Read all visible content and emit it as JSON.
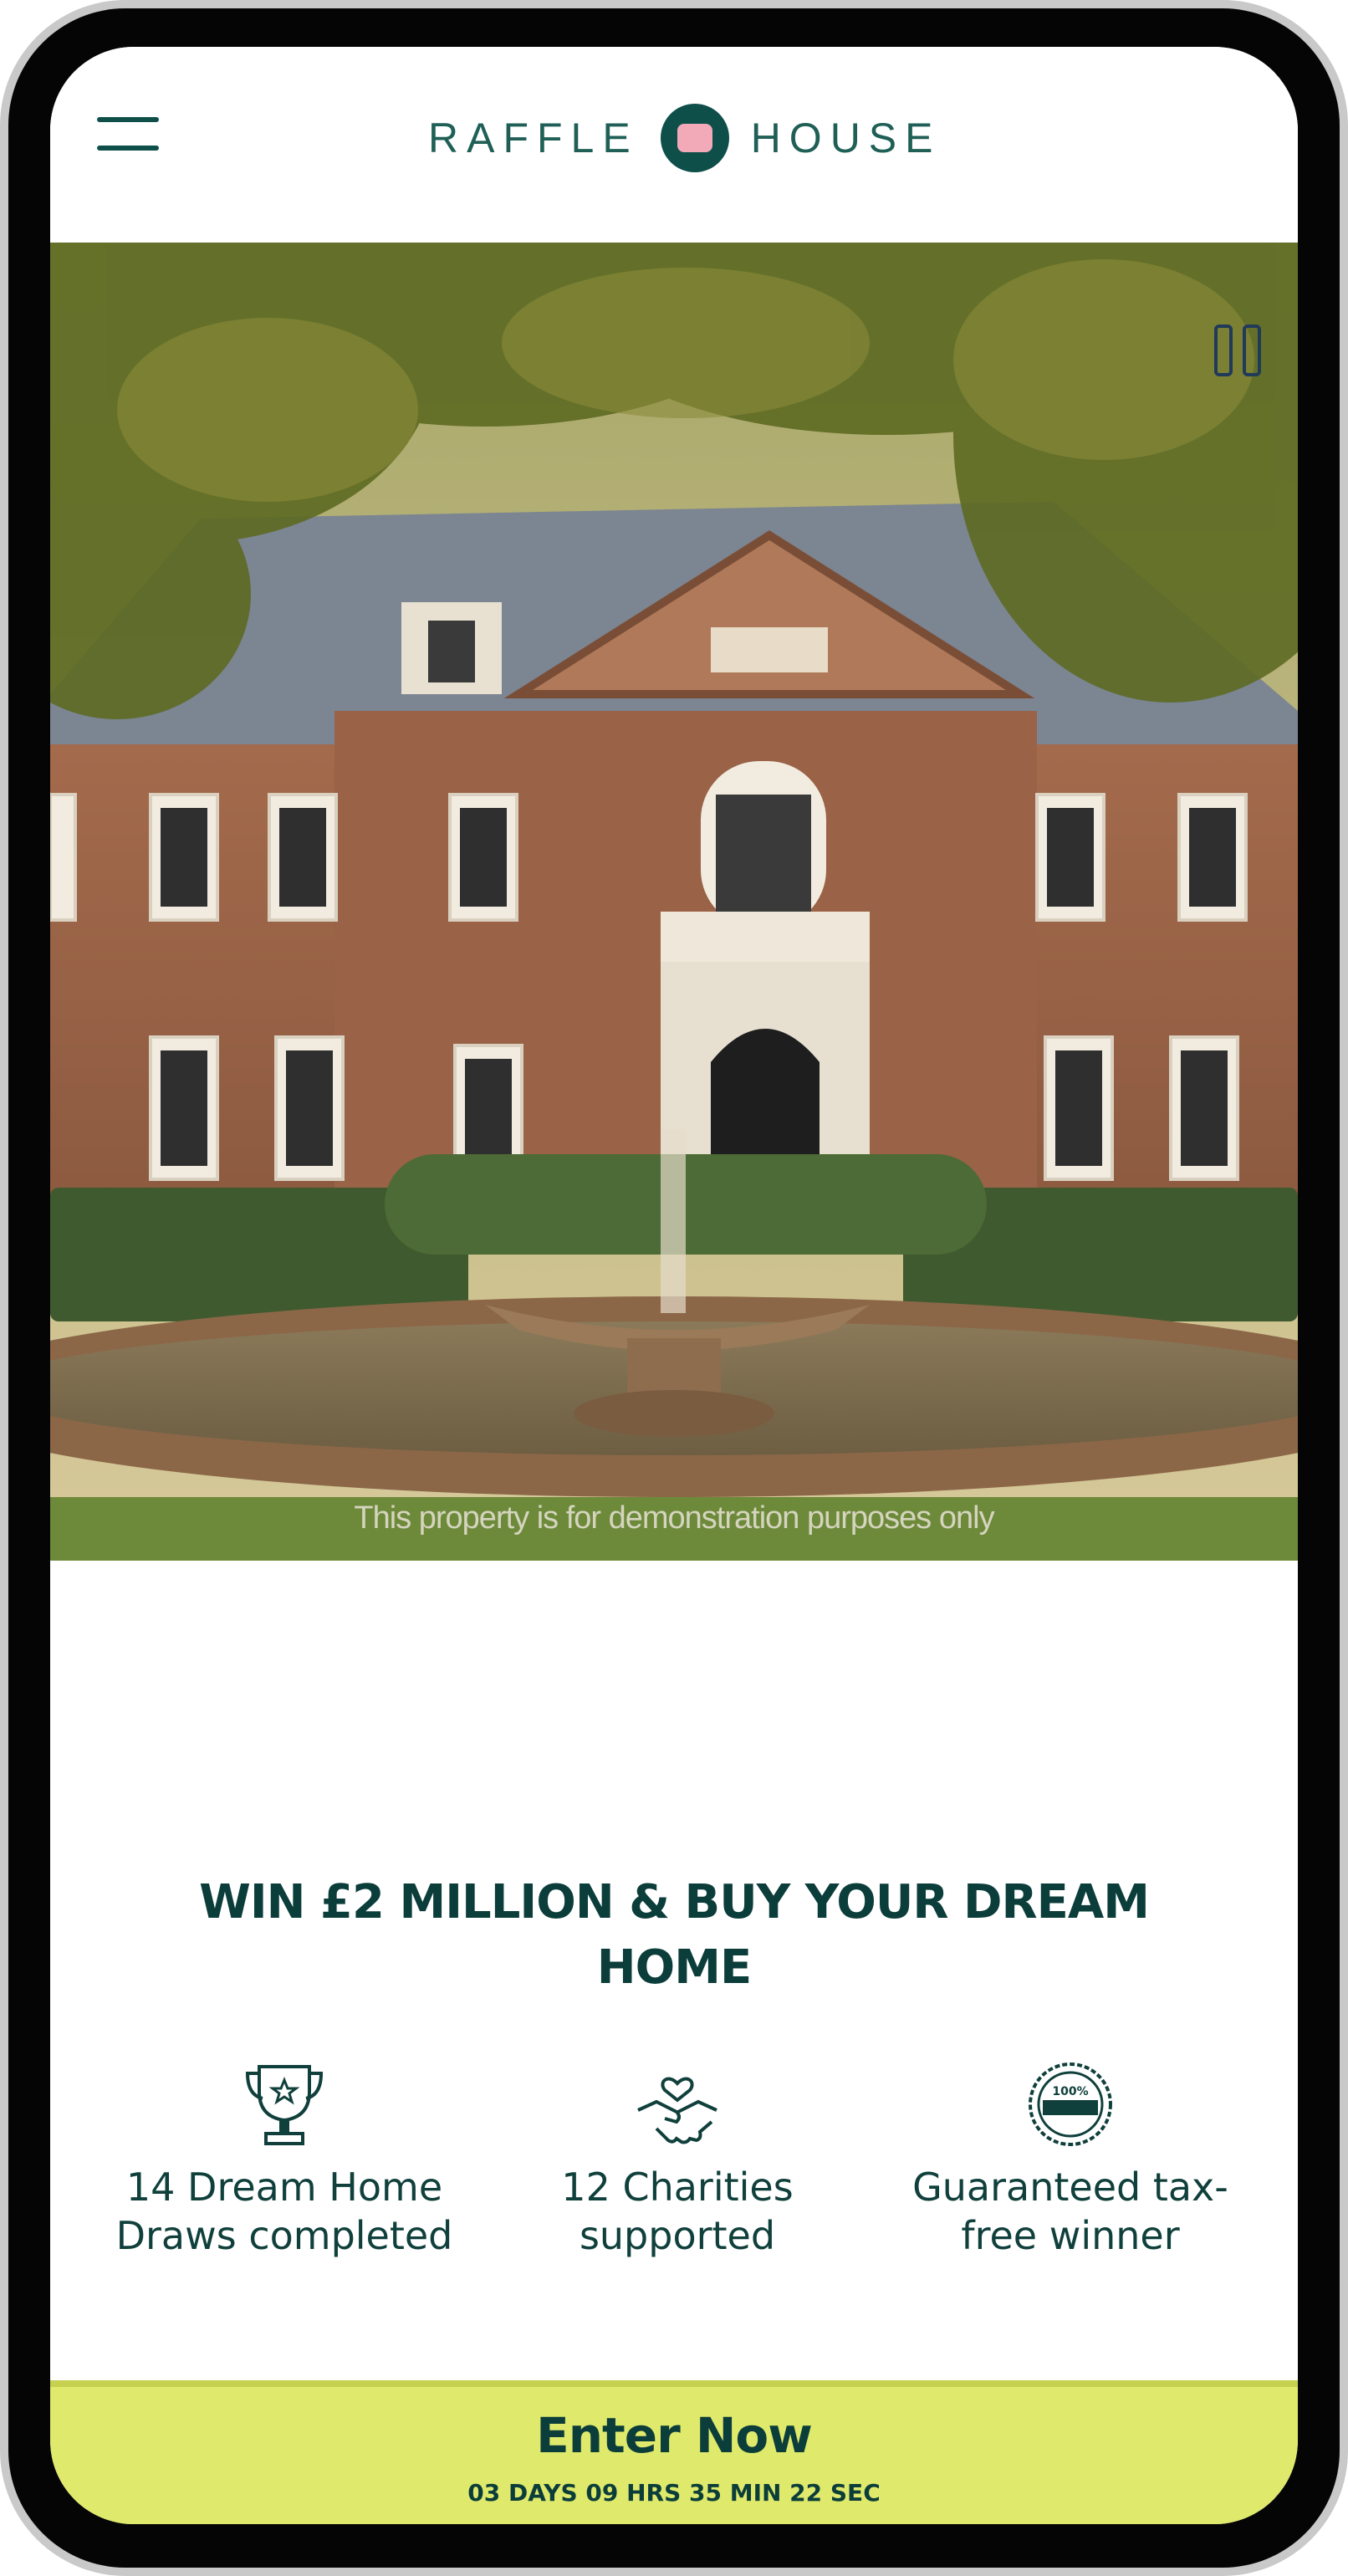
{
  "header": {
    "logo_left": "RAFFLE",
    "logo_right": "HOUSE",
    "menu_icon": "hamburger-menu-icon"
  },
  "hero": {
    "disclaimer": "This property is for demonstration purposes only",
    "pause_icon": "pause-icon"
  },
  "main": {
    "headline": "WIN £2 MILLION & BUY YOUR DREAM HOME",
    "features": [
      {
        "icon": "trophy-icon",
        "text": "14 Dream Home Draws completed"
      },
      {
        "icon": "handshake-heart-icon",
        "text": "12 Charities supported"
      },
      {
        "icon": "guarantee-badge-icon",
        "text": "Guaranteed tax-free winner"
      }
    ]
  },
  "cta": {
    "label": "Enter Now",
    "countdown": "03 DAYS 09 HRS 35 MIN 22 SEC"
  },
  "colors": {
    "brand_dark": "#0b3d3a",
    "logo_green": "#1f5f56",
    "cta_yellow": "#dfe96b",
    "logo_pink": "#f2a9b8"
  }
}
